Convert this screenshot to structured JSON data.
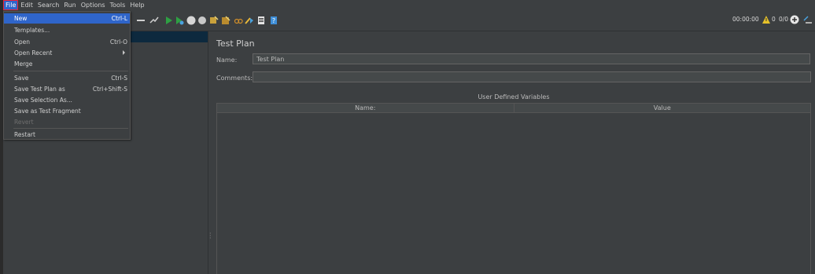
{
  "menubar": {
    "items": [
      "File",
      "Edit",
      "Search",
      "Run",
      "Options",
      "Tools",
      "Help"
    ]
  },
  "file_menu": {
    "items": [
      {
        "label": "New",
        "shortcut": "Ctrl-L"
      },
      {
        "label": "Templates...",
        "shortcut": ""
      },
      {
        "label": "Open",
        "shortcut": "Ctrl-O"
      },
      {
        "label": "Open Recent",
        "shortcut": ""
      },
      {
        "label": "Merge",
        "shortcut": ""
      },
      {
        "label": "Save",
        "shortcut": "Ctrl-S"
      },
      {
        "label": "Save Test Plan as",
        "shortcut": "Ctrl+Shift-S"
      },
      {
        "label": "Save Selection As...",
        "shortcut": ""
      },
      {
        "label": "Save as Test Fragment",
        "shortcut": ""
      },
      {
        "label": "Revert",
        "shortcut": ""
      },
      {
        "label": "Restart",
        "shortcut": ""
      }
    ]
  },
  "status": {
    "elapsed": "00:00:00",
    "warnings": "0",
    "threads": "0/0"
  },
  "main": {
    "title": "Test Plan",
    "name_label": "Name:",
    "name_value": "Test Plan",
    "comments_label": "Comments:",
    "comments_value": "",
    "udv_title": "User Defined Variables",
    "columns": [
      "Name:",
      "Value"
    ]
  },
  "colors": {
    "background": "#3c3f41",
    "selection": "#2f65ca",
    "highlight_border": "#e5233b"
  }
}
